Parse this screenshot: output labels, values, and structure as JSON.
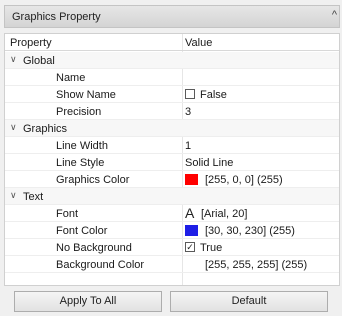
{
  "panel": {
    "title": "Graphics Property"
  },
  "grid": {
    "header": {
      "property": "Property",
      "value": "Value"
    },
    "categories": [
      {
        "label": "Global",
        "properties": [
          {
            "name": "Name",
            "value": ""
          },
          {
            "name": "Show Name",
            "value": "False",
            "kind": "checkbox",
            "checked": false
          },
          {
            "name": "Precision",
            "value": "3"
          }
        ]
      },
      {
        "label": "Graphics",
        "properties": [
          {
            "name": "Line Width",
            "value": "1"
          },
          {
            "name": "Line Style",
            "value": "Solid Line"
          },
          {
            "name": "Graphics Color",
            "value": "[255, 0, 0] (255)",
            "kind": "color",
            "color": "#ff0000"
          }
        ]
      },
      {
        "label": "Text",
        "properties": [
          {
            "name": "Font",
            "value": "[Arial, 20]",
            "kind": "font",
            "glyph": "A"
          },
          {
            "name": "Font Color",
            "value": "[30, 30, 230] (255)",
            "kind": "color",
            "color": "#1e1ee6"
          },
          {
            "name": "No Background",
            "value": "True",
            "kind": "checkbox",
            "checked": true,
            "check_glyph": "✓"
          },
          {
            "name": "Background Color",
            "value": "[255, 255, 255] (255)",
            "kind": "color",
            "color": "#ffffff"
          }
        ]
      }
    ]
  },
  "buttons": {
    "apply_all": "Apply To All",
    "default": "Default"
  }
}
